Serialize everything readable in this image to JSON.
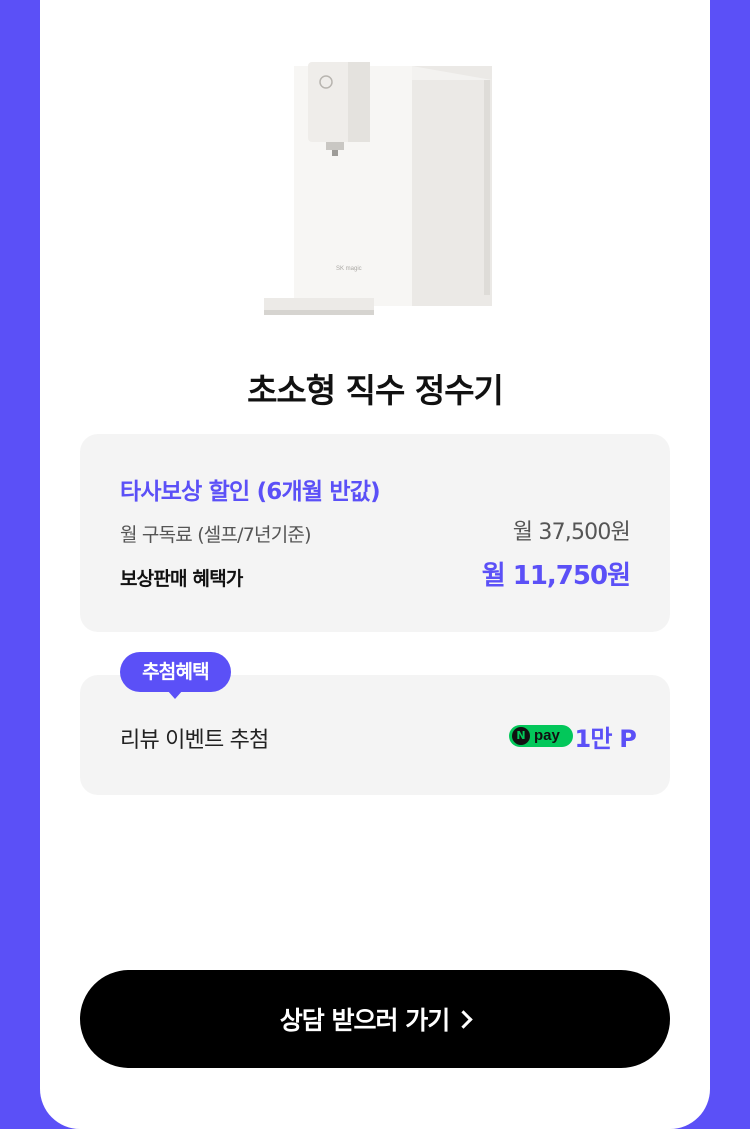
{
  "product": {
    "image_name": "water-purifier-image",
    "title": "초소형 직수 정수기"
  },
  "trade_in": {
    "heading": "타사보상 할인 (6개월 반값)",
    "monthly_label": "월 구독료 (셀프/7년기준)",
    "monthly_price": "월 37,500원",
    "benefit_label": "보상판매 혜택가",
    "benefit_price": "월 11,750원"
  },
  "raffle": {
    "badge": "추첨혜택",
    "label": "리뷰 이벤트 추첨",
    "npay_n": "N",
    "npay_text": "pay",
    "points": "1만 P"
  },
  "cta": {
    "label": "상담 받으러 가기"
  },
  "colors": {
    "accent": "#5b50f7",
    "npay_green": "#03c75a",
    "cta_bg": "#000000"
  }
}
